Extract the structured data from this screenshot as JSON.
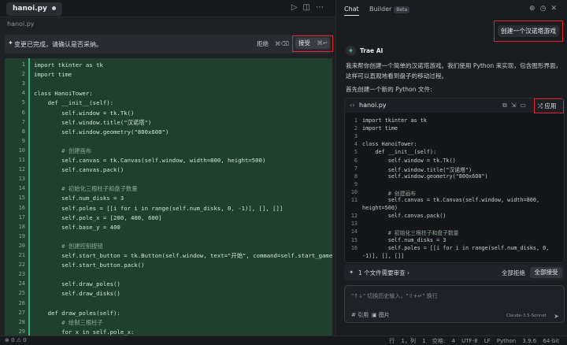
{
  "editor": {
    "tab": "hanoi.py",
    "breadcrumb": "hanoi.py",
    "notice": "变更已完成，请确认是否采纳。",
    "reject_label": "拒绝",
    "reject_key": "⌘⌫",
    "accept_label": "接受",
    "accept_key": "⌘↵",
    "lines": [
      {
        "n": "1",
        "t": "import tkinter as tk"
      },
      {
        "n": "2",
        "t": "import time"
      },
      {
        "n": "3",
        "t": ""
      },
      {
        "n": "4",
        "t": "class HanoiTower:"
      },
      {
        "n": "5",
        "t": "    def __init__(self):"
      },
      {
        "n": "6",
        "t": "        self.window = tk.Tk()"
      },
      {
        "n": "7",
        "t": "        self.window.title(\"汉诺塔\")"
      },
      {
        "n": "8",
        "t": "        self.window.geometry(\"800x600\")"
      },
      {
        "n": "9",
        "t": ""
      },
      {
        "n": "10",
        "t": "        # 创建画布"
      },
      {
        "n": "11",
        "t": "        self.canvas = tk.Canvas(self.window, width=800, height=500)"
      },
      {
        "n": "12",
        "t": "        self.canvas.pack()"
      },
      {
        "n": "13",
        "t": ""
      },
      {
        "n": "14",
        "t": "        # 初始化三根柱子和盘子数量"
      },
      {
        "n": "15",
        "t": "        self.num_disks = 3"
      },
      {
        "n": "16",
        "t": "        self.poles = [[i for i in range(self.num_disks, 0, -1)], [], []]"
      },
      {
        "n": "17",
        "t": "        self.pole_x = [200, 400, 600]"
      },
      {
        "n": "18",
        "t": "        self.base_y = 400"
      },
      {
        "n": "19",
        "t": ""
      },
      {
        "n": "20",
        "t": "        # 创建控制按钮"
      },
      {
        "n": "21",
        "t": "        self.start_button = tk.Button(self.window, text=\"开始\", command=self.start_game)"
      },
      {
        "n": "22",
        "t": "        self.start_button.pack()"
      },
      {
        "n": "23",
        "t": ""
      },
      {
        "n": "24",
        "t": "        self.draw_poles()"
      },
      {
        "n": "25",
        "t": "        self.draw_disks()"
      },
      {
        "n": "26",
        "t": ""
      },
      {
        "n": "27",
        "t": "    def draw_poles(self):"
      },
      {
        "n": "28",
        "t": "        # 绘制三根柱子"
      },
      {
        "n": "29",
        "t": "        for x in self.pole_x:"
      }
    ]
  },
  "status": {
    "left": "⊗ 0  ⚠ 0",
    "right": "行 1，列 1  空格: 4  UTF-8  LF  Python  3.9.6 64-bit"
  },
  "chat": {
    "tab_chat": "Chat",
    "tab_builder": "Builder",
    "beta": "Beta",
    "user_message": "创建一个汉诺塔游戏",
    "ai_name": "Trae AI",
    "intro": "我来帮你创建一个简单的汉诺塔游戏。我们使用 Python 来实现，包含图形界面，这样可以直观地看到盘子的移动过程。",
    "first": "首先创建一个新的 Python 文件:",
    "card_file": "hanoi.py",
    "apply": "应用",
    "card_lines": [
      {
        "n": "1",
        "t": "import tkinter as tk"
      },
      {
        "n": "2",
        "t": "import time"
      },
      {
        "n": "3",
        "t": ""
      },
      {
        "n": "4",
        "t": "class HanoiTower:"
      },
      {
        "n": "5",
        "t": "    def __init__(self):"
      },
      {
        "n": "6",
        "t": "        self.window = tk.Tk()"
      },
      {
        "n": "7",
        "t": "        self.window.title(\"汉诺塔\")"
      },
      {
        "n": "8",
        "t": "        self.window.geometry(\"800x600\")"
      },
      {
        "n": "9",
        "t": ""
      },
      {
        "n": "10",
        "t": "        # 创建画布"
      },
      {
        "n": "11",
        "t": "        self.canvas = tk.Canvas(self.window, width=800,"
      },
      {
        "n": "",
        "t": "height=500)"
      },
      {
        "n": "12",
        "t": "        self.canvas.pack()"
      },
      {
        "n": "13",
        "t": ""
      },
      {
        "n": "14",
        "t": "        # 初始化三根柱子和盘子数量"
      },
      {
        "n": "15",
        "t": "        self.num_disks = 3"
      },
      {
        "n": "16",
        "t": "        self.poles = [[i for i in range(self.num_disks, 0,"
      },
      {
        "n": "",
        "t": "-1)], [], []]"
      }
    ],
    "review": "1 个文件需要审查",
    "reject_all": "全部拒绝",
    "accept_all": "全部接受",
    "placeholder": "\"↑↓\" 切换历史输入，\"⇧+↵\" 换行",
    "ref": "# 引用",
    "image": "图片",
    "model": "Claude-3.5-Sonnet"
  }
}
